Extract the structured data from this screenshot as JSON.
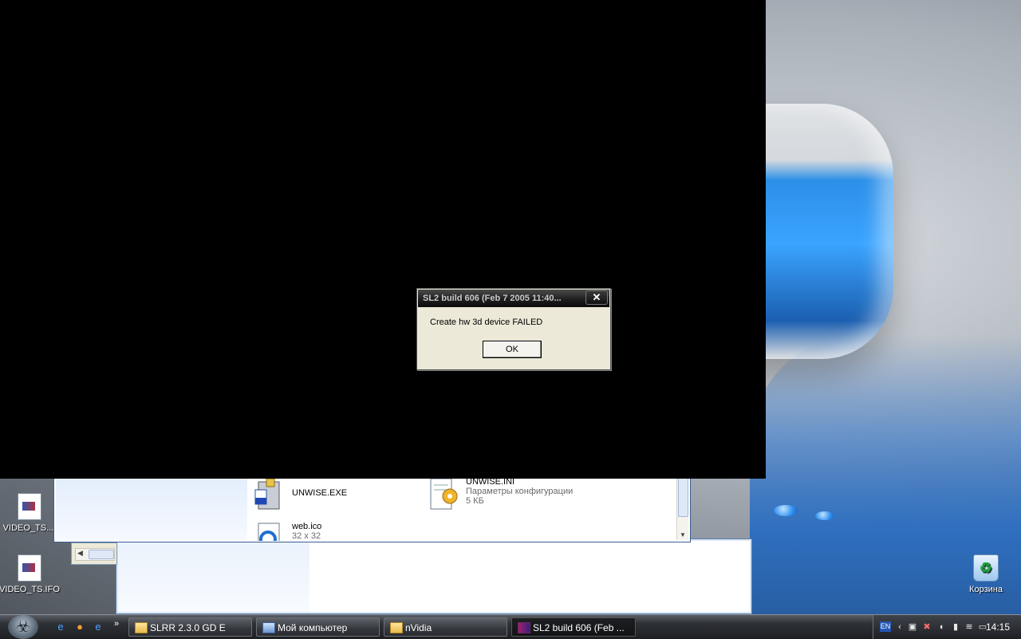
{
  "desktop": {
    "icons": [
      {
        "label": "VIDEO_TS...."
      },
      {
        "label": "VIDEO_TS.IFO"
      },
      {
        "label": "Корзина"
      }
    ]
  },
  "explorer": {
    "files": [
      {
        "name": "UNWISE.EXE",
        "meta1": "",
        "meta2": ""
      },
      {
        "name": "UNWISE.INI",
        "meta1": "Параметры конфигурации",
        "meta2": "5 КБ"
      },
      {
        "name": "web.ico",
        "meta1": "32 x 32",
        "meta2": ""
      }
    ]
  },
  "dialog": {
    "title": "SL2 build 606 (Feb  7 2005 11:40...",
    "message": "Create hw 3d device FAILED",
    "ok_label": "OK",
    "close_glyph": "✕"
  },
  "taskbar": {
    "quick_launch_more": "»",
    "buttons": [
      {
        "label": "SLRR 2.3.0 GD E",
        "icon": "folder-icon"
      },
      {
        "label": "Мой компьютер",
        "icon": "my-computer-icon"
      },
      {
        "label": "nVidia",
        "icon": "folder-icon"
      },
      {
        "label": "SL2 build 606 (Feb ...",
        "icon": "game-icon"
      }
    ],
    "tray": {
      "language": "EN",
      "clock": "14:15"
    }
  }
}
